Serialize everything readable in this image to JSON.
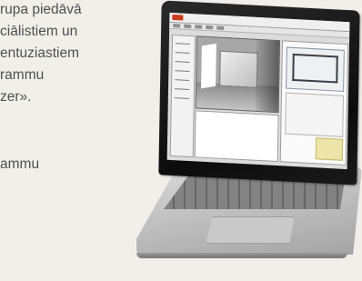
{
  "article_text": {
    "lines": [
      "rupa piedāvā",
      "ciālistiem un",
      "entuziastiem",
      "rammu",
      "zer».",
      "",
      "ammu"
    ]
  },
  "laptop": {
    "screen_app": {
      "brand_color": "#cc3a1e"
    }
  }
}
